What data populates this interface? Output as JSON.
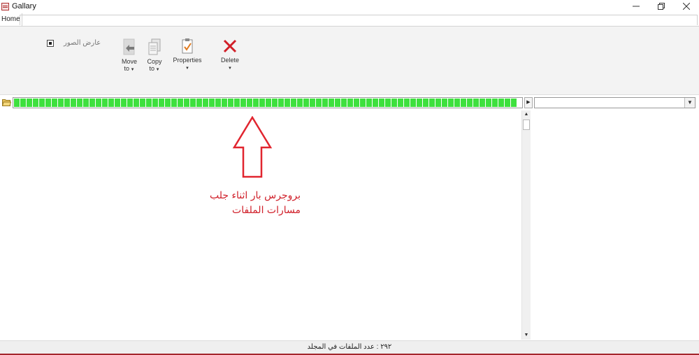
{
  "window": {
    "title": "Gallary"
  },
  "ribbon": {
    "tab_home": "Home",
    "viewer_label": "عارض الصور",
    "move": {
      "line1": "Move",
      "line2": "to"
    },
    "copy": {
      "line1": "Copy",
      "line2": "to"
    },
    "properties": {
      "label": "Properties"
    },
    "delete": {
      "label": "Delete"
    }
  },
  "progress": {
    "fraction": 1.0,
    "color": "#3ee03e"
  },
  "annotation": {
    "line1": "بروجرس بار اثناء جلب",
    "line2": "مسارات الملفات",
    "color": "#d0202a"
  },
  "status": {
    "text": "٢٩٢ : عدد الملفات في المجلد"
  }
}
